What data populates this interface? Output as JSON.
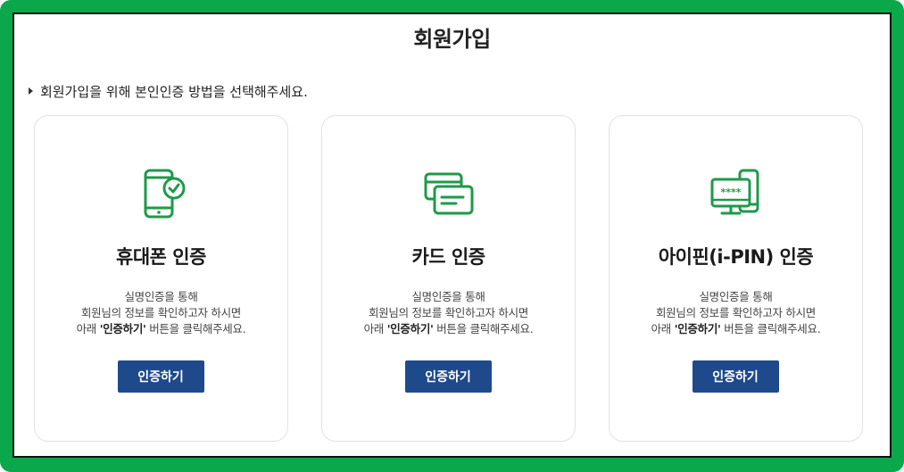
{
  "page": {
    "title": "회원가입",
    "guide": "회원가입을 위해 본인인증 방법을 선택해주세요."
  },
  "colors": {
    "frame": "#0aa84b",
    "icon": "#1e9a4a",
    "button": "#1e4a8c"
  },
  "cards": [
    {
      "icon": "mobile-phone-check-icon",
      "title": "휴대폰 인증",
      "desc_line1": "실명인증을 통해",
      "desc_line2": "회원님의 정보를 확인하고자 하시면",
      "desc_line3_pre": "아래 ",
      "desc_line3_bold": "'인증하기'",
      "desc_line3_post": " 버튼을 클릭해주세요.",
      "button": "인증하기"
    },
    {
      "icon": "credit-card-icon",
      "title": "카드 인증",
      "desc_line1": "실명인증을 통해",
      "desc_line2": "회원님의 정보를 확인하고자 하시면",
      "desc_line3_pre": "아래 ",
      "desc_line3_bold": "'인증하기'",
      "desc_line3_post": " 버튼을 클릭해주세요.",
      "button": "인증하기"
    },
    {
      "icon": "ipin-monitor-icon",
      "title": "아이핀(i-PIN) 인증",
      "desc_line1": "실명인증을 통해",
      "desc_line2": "회원님의 정보를 확인하고자 하시면",
      "desc_line3_pre": "아래 ",
      "desc_line3_bold": "'인증하기'",
      "desc_line3_post": " 버튼을 클릭해주세요.",
      "button": "인증하기",
      "icon_text": "****"
    }
  ]
}
